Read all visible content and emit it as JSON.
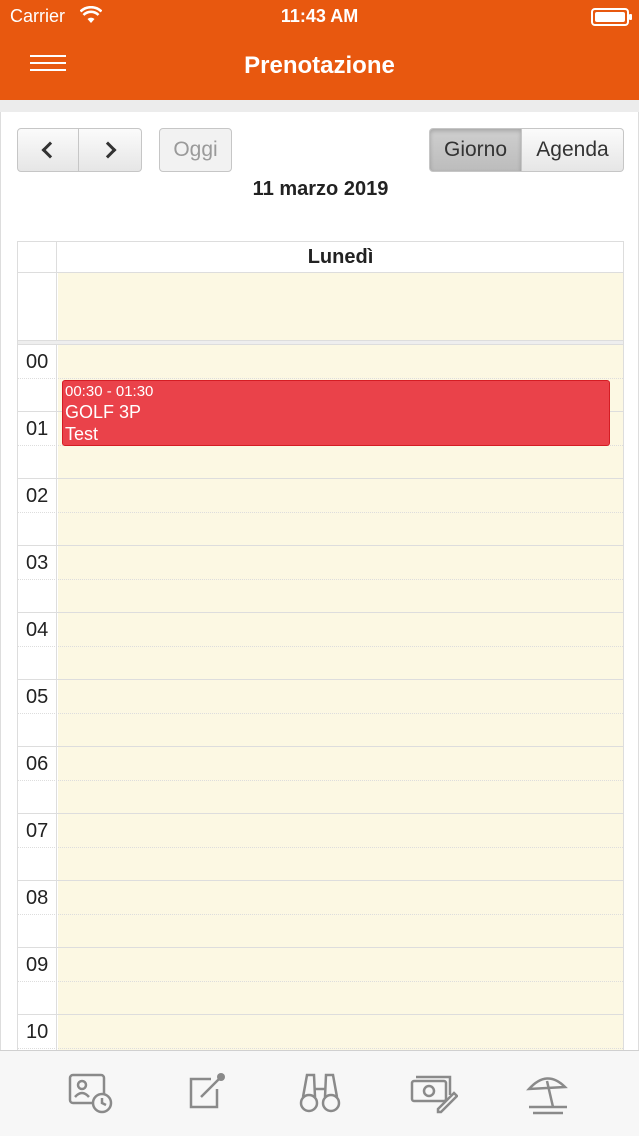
{
  "status": {
    "carrier": "Carrier",
    "time": "11:43 AM"
  },
  "nav": {
    "title": "Prenotazione"
  },
  "toolbar": {
    "today_label": "Oggi",
    "day_label": "Giorno",
    "agenda_label": "Agenda",
    "active_view": "Giorno"
  },
  "calendar": {
    "date_title": "11 marzo 2019",
    "day_header": "Lunedì",
    "hours": [
      "00",
      "01",
      "02",
      "03",
      "04",
      "05",
      "06",
      "07",
      "08",
      "09",
      "10"
    ],
    "event": {
      "time": "00:30 - 01:30",
      "title": "GOLF 3P",
      "note": "Test",
      "color": "#ea424a"
    }
  },
  "tabbar": {
    "icons": [
      "contact-calendar-icon",
      "edit-share-icon",
      "binoculars-icon",
      "payment-edit-icon",
      "beach-umbrella-icon"
    ]
  },
  "colors": {
    "brand": "#e8580f",
    "slot_background": "#fcf8e3"
  }
}
